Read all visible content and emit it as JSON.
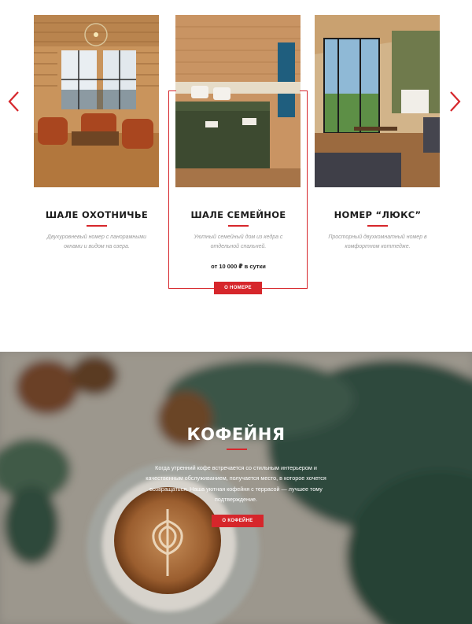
{
  "carousel": {
    "rooms": [
      {
        "title": "ШАЛЕ ОХОТНИЧЬЕ",
        "description": "Двухуровневый номер с панорамными окнами и видом на озера.",
        "price": ""
      },
      {
        "title": "ШАЛЕ СЕМЕЙНОЕ",
        "description": "Уютный семейный дом из кедра с отдельной спальней.",
        "price": "от 10 000 ₽ в сутки",
        "button": "О НОМЕРЕ"
      },
      {
        "title": "НОМЕР “ЛЮКС”",
        "description": "Просторный двухкомнатный номер в комфортном коттедже.",
        "price": ""
      }
    ],
    "icons": {
      "prev": "chevron-left-icon",
      "next": "chevron-right-icon"
    }
  },
  "cafe": {
    "title": "КОФЕЙНЯ",
    "text": "Когда утренний кофе встречается со стильным интерьером и качественным обслуживанием, получается место, в которое хочется возвращаться. Наша уютная кофейня с террасой — лучшее тому подтверждение.",
    "button": "О КОФЕЙНЕ"
  },
  "colors": {
    "accent": "#d6262b",
    "text": "#1d1d1d",
    "muted": "#9a9a9a"
  }
}
